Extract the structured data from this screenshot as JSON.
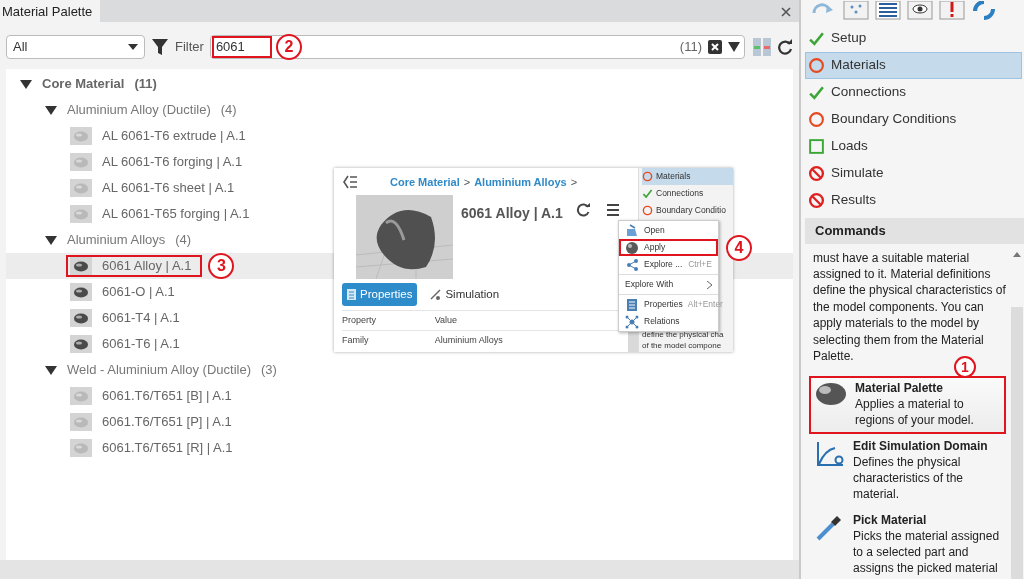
{
  "tab": {
    "title": "Material Palette"
  },
  "filter": {
    "scope": "All",
    "label": "Filter",
    "value": "6061",
    "count": "(11)",
    "highlighted": true,
    "callout": "2"
  },
  "tree": [
    {
      "label": "Core Material",
      "count": "(11)",
      "expanded": true,
      "children": [
        {
          "label": "Aluminium Alloy (Ductile)",
          "count": "(4)",
          "expanded": true,
          "children": [
            {
              "label": "AL 6061-T6 extrude | A.1",
              "kind": "light",
              "selected": false,
              "highlighted": false
            },
            {
              "label": "AL 6061-T6 forging | A.1",
              "kind": "light",
              "selected": false,
              "highlighted": false
            },
            {
              "label": "AL 6061-T6 sheet | A.1",
              "kind": "light",
              "selected": false,
              "highlighted": false
            },
            {
              "label": "AL 6061-T65 forging | A.1",
              "kind": "light",
              "selected": false,
              "highlighted": false
            }
          ]
        },
        {
          "label": "Aluminium Alloys",
          "count": "(4)",
          "expanded": true,
          "children": [
            {
              "label": "6061 Alloy | A.1",
              "kind": "dark",
              "selected": true,
              "highlighted": true,
              "callout": "3"
            },
            {
              "label": "6061-O | A.1",
              "kind": "dark",
              "selected": false,
              "highlighted": false
            },
            {
              "label": "6061-T4 | A.1",
              "kind": "dark",
              "selected": false,
              "highlighted": false
            },
            {
              "label": "6061-T6 | A.1",
              "kind": "dark",
              "selected": false,
              "highlighted": false
            }
          ]
        },
        {
          "label": "Weld - Aluminium Alloy (Ductile)",
          "count": "(3)",
          "expanded": true,
          "children": [
            {
              "label": "6061.T6/T651 [B] | A.1",
              "kind": "light",
              "selected": false,
              "highlighted": false
            },
            {
              "label": "6061.T6/T651 [P] | A.1",
              "kind": "light",
              "selected": false,
              "highlighted": false
            },
            {
              "label": "6061.T6/T651 [R] | A.1",
              "kind": "light",
              "selected": false,
              "highlighted": false
            }
          ]
        }
      ]
    }
  ],
  "steps": [
    {
      "label": "Setup",
      "kind": "done",
      "selected": false
    },
    {
      "label": "Materials",
      "kind": "pending",
      "selected": true
    },
    {
      "label": "Connections",
      "kind": "done",
      "selected": false
    },
    {
      "label": "Boundary Conditions",
      "kind": "pending",
      "selected": false
    },
    {
      "label": "Loads",
      "kind": "todo",
      "selected": false
    },
    {
      "label": "Simulate",
      "kind": "blocked",
      "selected": false
    },
    {
      "label": "Results",
      "kind": "blocked",
      "selected": false
    }
  ],
  "commands": {
    "title": "Commands",
    "description": "must have a suitable material assigned to it. Material definitions define the physical characteristics of the model components. You can apply materials to the model by selecting them from the Material Palette.",
    "items": [
      {
        "kind": "material",
        "title": "Material Palette",
        "text": "Applies a material to regions of your model.",
        "highlighted": true,
        "callout": "1"
      },
      {
        "kind": "domain",
        "title": "Edit Simulation Domain",
        "text": "Defines the physical characteristics of the material.",
        "highlighted": false
      },
      {
        "kind": "pipette",
        "title": "Pick Material",
        "text": "Picks the material assigned to a selected part and assigns the picked material",
        "highlighted": false
      }
    ]
  },
  "inset": {
    "breadcrumb": [
      {
        "label": "Core Material",
        "kind": "link"
      },
      {
        "label": ">",
        "kind": "sep"
      },
      {
        "label": "Aluminium Alloys",
        "kind": "link"
      },
      {
        "label": ">",
        "kind": "sep"
      }
    ],
    "title": "6061 Alloy | A.1",
    "tabs": [
      {
        "label": "Properties",
        "selected": true
      },
      {
        "label": "Simulation",
        "selected": false
      }
    ],
    "columns": [
      "Property",
      "Value"
    ],
    "rows": [
      [
        "Family",
        "Aluminium Alloys"
      ]
    ],
    "steps": [
      {
        "label": "Materials",
        "kind": "pending",
        "selected": true
      },
      {
        "label": "Connections",
        "kind": "done",
        "selected": false
      },
      {
        "label": "Boundary Conditio",
        "kind": "pending",
        "selected": false
      }
    ],
    "text_lines": [
      "define the physical cha",
      "of the model compone"
    ],
    "menu": [
      {
        "kind": "open",
        "label": "Open",
        "highlighted": false
      },
      {
        "kind": "apply",
        "label": "Apply",
        "highlighted": true,
        "callout": "4"
      },
      {
        "kind": "explore",
        "label": "Explore ...",
        "shortcut": "Ctrl+E",
        "highlighted": false
      },
      {
        "kind": "submenu",
        "label": "Explore With",
        "highlighted": false
      },
      {
        "kind": "properties",
        "label": "Properties",
        "shortcut": "Alt+Enter",
        "highlighted": false
      },
      {
        "kind": "relations",
        "label": "Relations",
        "highlighted": false
      }
    ]
  }
}
